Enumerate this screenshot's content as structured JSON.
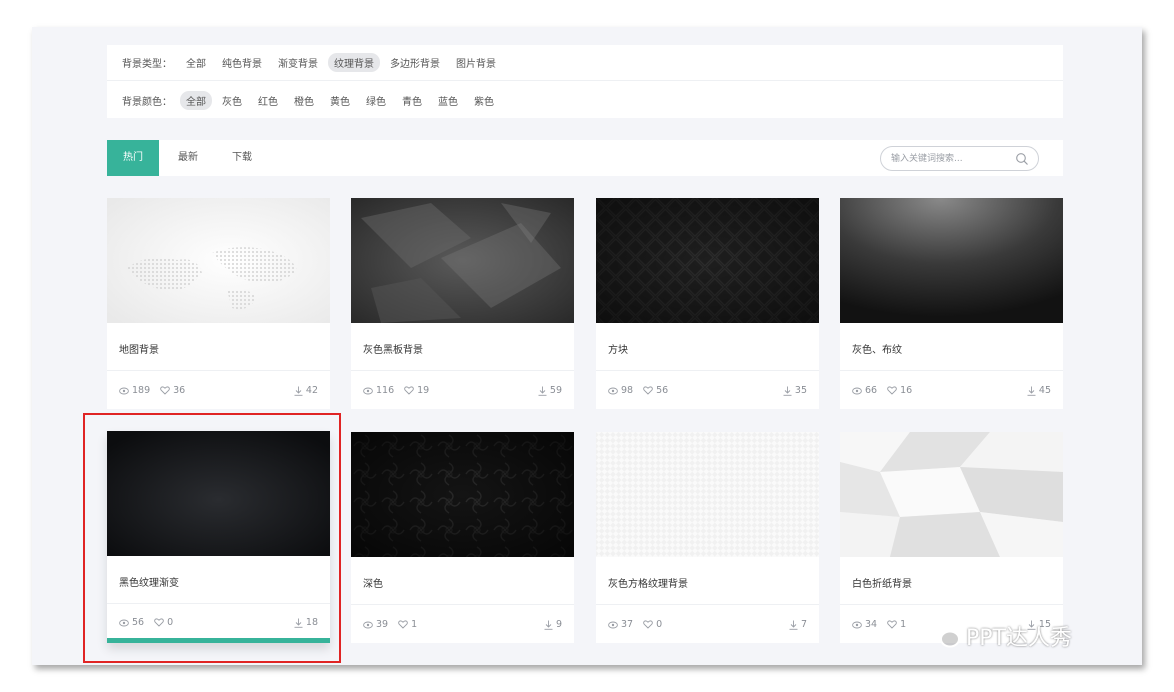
{
  "filters": {
    "type_label": "背景类型：",
    "type_options": [
      "全部",
      "纯色背景",
      "渐变背景",
      "纹理背景",
      "多边形背景",
      "图片背景"
    ],
    "type_selected": 3,
    "color_label": "背景颜色：",
    "color_options": [
      "全部",
      "灰色",
      "红色",
      "橙色",
      "黄色",
      "绿色",
      "青色",
      "蓝色",
      "紫色"
    ],
    "color_selected": 0
  },
  "tabs": [
    {
      "label": "热门",
      "active": true
    },
    {
      "label": "最新",
      "active": false
    },
    {
      "label": "下载",
      "active": false
    }
  ],
  "search": {
    "placeholder": "输入关键词搜索..."
  },
  "cards": [
    {
      "title": "地图背景",
      "views": "189",
      "likes": "36",
      "downloads": "42",
      "thumb": "world-map-light"
    },
    {
      "title": "灰色黑板背景",
      "views": "116",
      "likes": "19",
      "downloads": "59",
      "thumb": "grunge-chalkboard"
    },
    {
      "title": "方块",
      "views": "98",
      "likes": "56",
      "downloads": "35",
      "thumb": "dark-diamond-pattern"
    },
    {
      "title": "灰色、布纹",
      "views": "66",
      "likes": "16",
      "downloads": "45",
      "thumb": "spotlight-fabric"
    },
    {
      "title": "黑色纹理渐变",
      "views": "56",
      "likes": "0",
      "downloads": "18",
      "thumb": "black-radial-gradient",
      "hovered": true
    },
    {
      "title": "深色",
      "views": "39",
      "likes": "1",
      "downloads": "9",
      "thumb": "dark-damask"
    },
    {
      "title": "灰色方格纹理背景",
      "views": "37",
      "likes": "0",
      "downloads": "7",
      "thumb": "light-check-pattern"
    },
    {
      "title": "白色折纸背景",
      "views": "34",
      "likes": "1",
      "downloads": "15",
      "thumb": "crumpled-paper"
    }
  ],
  "watermark": {
    "text": "PPT达人秀",
    "icon": "wechat-icon"
  },
  "colors": {
    "accent": "#37b39a",
    "highlight": "#e02424",
    "page_bg": "#f4f5f9"
  }
}
